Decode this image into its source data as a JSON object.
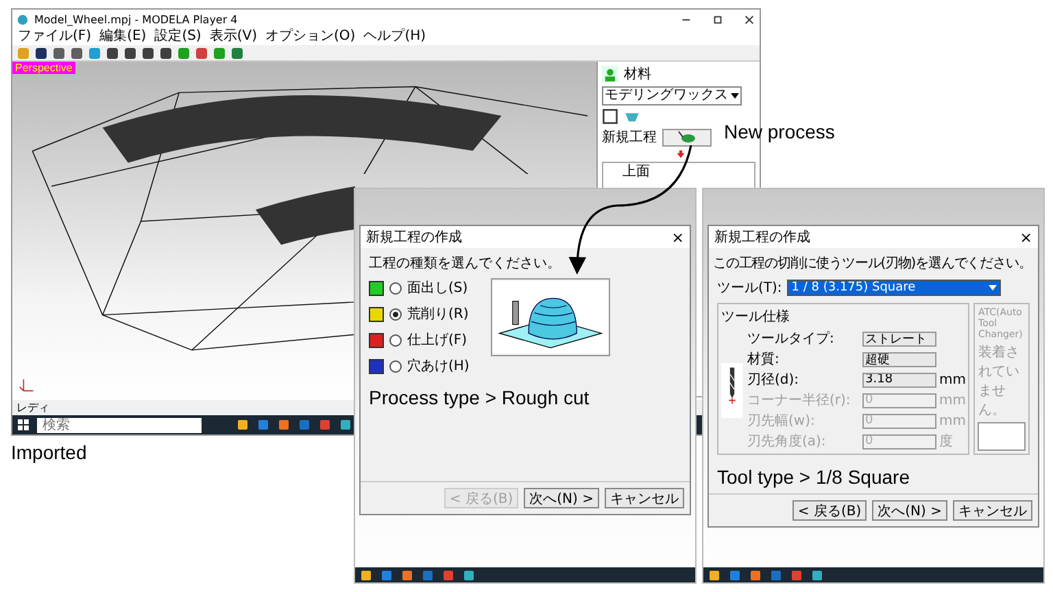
{
  "main_window": {
    "title": "Model_Wheel.mpj - MODELA Player 4",
    "menu": [
      "ファイル(F)",
      "編集(E)",
      "設定(S)",
      "表示(V)",
      "オプション(O)",
      "ヘルプ(H)"
    ],
    "view_label": "Perspective",
    "material_label": "材料",
    "material": "モデリングワックス",
    "new_process_label": "新規工程",
    "tree": [
      {
        "label": "上面"
      }
    ],
    "status": "レディ",
    "taskbar_search": {
      "placeholder": "検索"
    }
  },
  "annotations": {
    "new_process": "New process",
    "imported": "Imported"
  },
  "process_dialog": {
    "title": "新規工程の作成",
    "close": "×",
    "prompt": "工程の種類を選んでください。",
    "options": [
      {
        "label": "面出し(S)",
        "selected": false,
        "color": "#22cc22"
      },
      {
        "label": "荒削り(R)",
        "selected": true,
        "color": "#e8d800"
      },
      {
        "label": "仕上げ(F)",
        "selected": false,
        "color": "#e02020"
      },
      {
        "label": "穴あけ(H)",
        "selected": false,
        "color": "#2030c0"
      }
    ],
    "caption": "Process type > Rough cut",
    "buttons": [
      {
        "label": "< 戻る(B)",
        "disabled": true
      },
      {
        "label": "次へ(N) >",
        "disabled": false
      },
      {
        "label": "キャンセル",
        "disabled": false
      }
    ]
  },
  "tool_dialog": {
    "title": "新規工程の作成",
    "close": "×",
    "prompt": "この工程の切削に使うツール(刃物)を選んでください。",
    "tool_label": "ツール(T):",
    "tool": "1 / 8 (3.175) Square",
    "spec_title": "ツール仕様",
    "specs": [
      {
        "label": "ツールタイプ:",
        "value": "ストレート",
        "disabled": false
      },
      {
        "label": "材質:",
        "value": "超硬",
        "disabled": false
      },
      {
        "label": "刃径(d):",
        "value": "3.18",
        "unit": "mm",
        "disabled": false
      },
      {
        "label": "コーナー半径(r):",
        "value": "0",
        "unit": "mm",
        "disabled": true
      },
      {
        "label": "刃先幅(w):",
        "value": "0",
        "unit": "mm",
        "disabled": true
      },
      {
        "label": "刃先角度(a):",
        "value": "0",
        "unit": "度",
        "disabled": true
      }
    ],
    "atc_title": "ATC(Auto Tool Changer)",
    "atc_note": "装着されていません。",
    "caption": "Tool type > 1/8 Square",
    "buttons": [
      {
        "label": "< 戻る(B)",
        "disabled": false
      },
      {
        "label": "次へ(N) >",
        "disabled": false
      },
      {
        "label": "キャンセル",
        "disabled": false
      }
    ]
  }
}
